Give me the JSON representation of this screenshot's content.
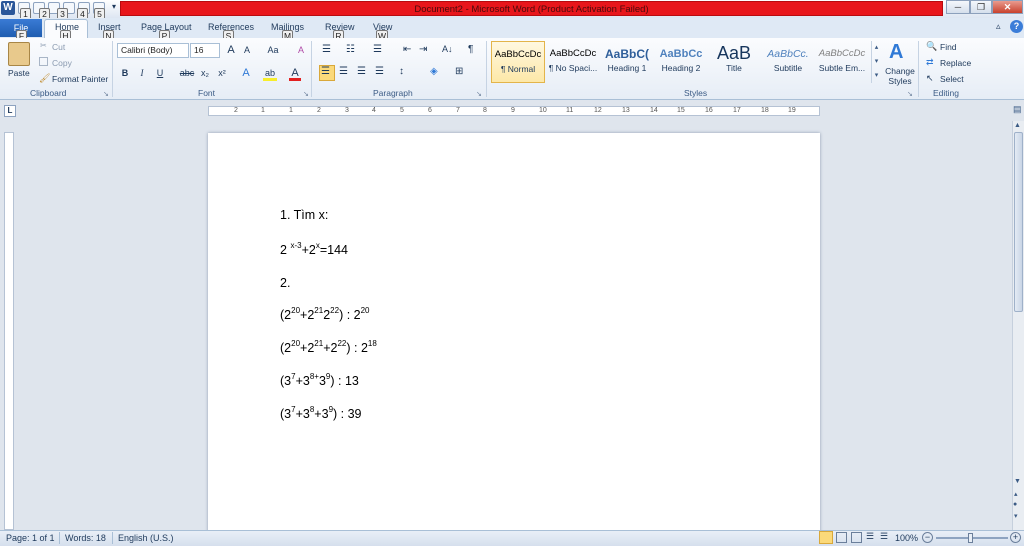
{
  "window": {
    "title": "Document2 - Microsoft Word (Product Activation Failed)",
    "minimize": "─",
    "restore": "❐",
    "close": "✕"
  },
  "qat": {
    "keytips": [
      "1",
      "2",
      "3",
      "4",
      "5"
    ],
    "customize": "▾"
  },
  "tabs": {
    "file": "File",
    "file_key": "F",
    "items": [
      {
        "label": "Home",
        "key": "H"
      },
      {
        "label": "Insert",
        "key": "N"
      },
      {
        "label": "Page Layout",
        "key": "P"
      },
      {
        "label": "References",
        "key": "S"
      },
      {
        "label": "Mailings",
        "key": "M"
      },
      {
        "label": "Review",
        "key": "R"
      },
      {
        "label": "View",
        "key": "W"
      }
    ],
    "minimize_ribbon": "▵",
    "help": "?"
  },
  "clipboard": {
    "paste": "Paste",
    "cut": "Cut",
    "copy": "Copy",
    "format_painter": "Format Painter",
    "label": "Clipboard"
  },
  "font": {
    "name": "Calibri (Body)",
    "size": "16",
    "grow": "A",
    "shrink": "A",
    "change_case": "Aa",
    "clear": "A",
    "bold": "B",
    "italic": "I",
    "underline": "U",
    "strike": "abc",
    "subscript": "x₂",
    "superscript": "x²",
    "effects": "A",
    "highlight": "ab",
    "color": "A",
    "label": "Font"
  },
  "paragraph": {
    "label": "Paragraph",
    "show_marks": "¶",
    "sort": "A↓"
  },
  "styles": {
    "label": "Styles",
    "items": [
      {
        "sample": "AaBbCcDc",
        "name": "¶ Normal"
      },
      {
        "sample": "AaBbCcDc",
        "name": "¶ No Spaci..."
      },
      {
        "sample": "AaBbC(",
        "name": "Heading 1"
      },
      {
        "sample": "AaBbCc",
        "name": "Heading 2"
      },
      {
        "sample": "AaB",
        "name": "Title"
      },
      {
        "sample": "AaBbCc.",
        "name": "Subtitle"
      },
      {
        "sample": "AaBbCcDc",
        "name": "Subtle Em..."
      }
    ],
    "change_styles": "Change Styles"
  },
  "editing": {
    "find": "Find",
    "replace": "Replace",
    "select": "Select",
    "label": "Editing"
  },
  "ruler": {
    "marks": [
      "2",
      "1",
      "1",
      "2",
      "3",
      "4",
      "5",
      "6",
      "7",
      "8",
      "9",
      "10",
      "11",
      "12",
      "13",
      "14",
      "15",
      "16",
      "17",
      "18",
      "19"
    ]
  },
  "document": {
    "q1": "1. Tìm x:",
    "eq1": {
      "base1": "2 ",
      "exp1": "x-3",
      "plus": "+2",
      "exp2": "x",
      "rest": "=144"
    },
    "q2": "2.",
    "lines": [
      {
        "open": "(2",
        "e1": "20",
        "p1": "+2",
        "e2": "21",
        "p2": "2",
        "e3": "22",
        "close": ") : 2",
        "e4": "20"
      },
      {
        "open": "(2",
        "e1": "20",
        "p1": "+2",
        "e2": "21",
        "p2": "+2",
        "e3": "22",
        "close": ") : 2",
        "e4": "18"
      },
      {
        "open": "(3",
        "e1": "7",
        "p1": "+3",
        "e2": "8+",
        "p2": "3",
        "e3": "9",
        "close": ") : 13",
        "e4": ""
      },
      {
        "open": "(3",
        "e1": "7",
        "p1": "+3",
        "e2": "8",
        "p2": "+3",
        "e3": "9",
        "close": ") : 39",
        "e4": ""
      }
    ]
  },
  "status": {
    "page": "Page: 1 of 1",
    "words": "Words: 18",
    "language": "English (U.S.)",
    "zoom": "100%",
    "zoom_minus": "−",
    "zoom_plus": "+"
  }
}
